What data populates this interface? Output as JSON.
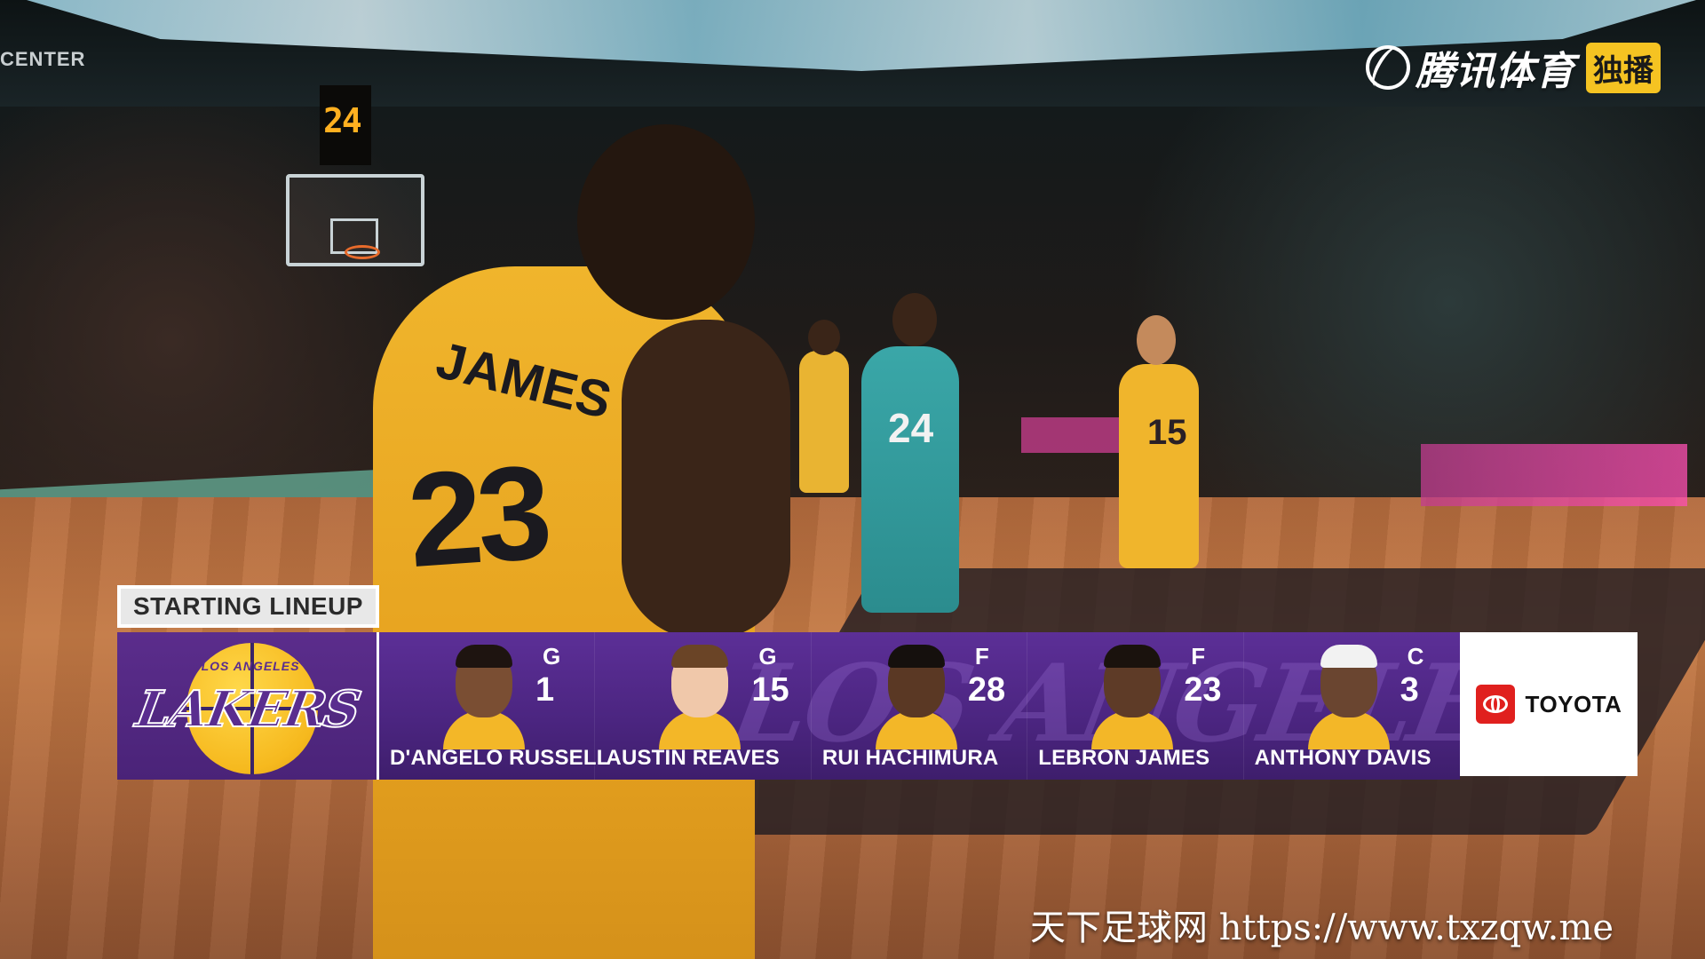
{
  "broadcast": {
    "network_name": "腾讯体育",
    "network_badge": "独播",
    "arena_text": "CENTER",
    "shot_clock": "24"
  },
  "jersey": {
    "name": "JAMES",
    "number": "23",
    "opponent_number": "24",
    "teammate_number": "15"
  },
  "lineup": {
    "title": "STARTING LINEUP",
    "team_logo_text": "LAKERS",
    "team_logo_top": "LOS ANGELES",
    "watermark": "LOS ANGELES LAKERS",
    "players": [
      {
        "position": "G",
        "number": "1",
        "name": "D'ANGELO RUSSELL"
      },
      {
        "position": "G",
        "number": "15",
        "name": "AUSTIN REAVES"
      },
      {
        "position": "F",
        "number": "28",
        "name": "RUI HACHIMURA"
      },
      {
        "position": "F",
        "number": "23",
        "name": "LEBRON JAMES"
      },
      {
        "position": "C",
        "number": "3",
        "name": "ANTHONY DAVIS"
      }
    ],
    "sponsor": "TOYOTA"
  },
  "site_watermark": "天下足球网 https://www.txzqw.me",
  "colors": {
    "lakers_purple": "#552583",
    "lakers_gold": "#FDB927",
    "toyota_red": "#E0201E",
    "tencent_badge": "#F5C322"
  }
}
